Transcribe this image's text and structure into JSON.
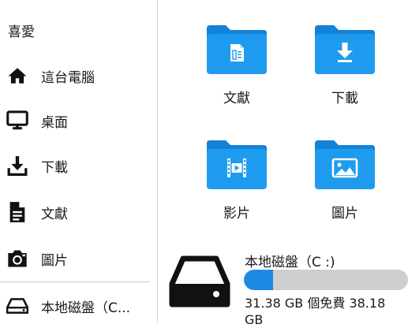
{
  "sidebar": {
    "header": "喜愛",
    "items": [
      {
        "label": "這台電腦",
        "icon": "home-icon"
      },
      {
        "label": "桌面",
        "icon": "desktop-monitor-icon"
      },
      {
        "label": "下載",
        "icon": "download-icon"
      },
      {
        "label": "文獻",
        "icon": "document-icon"
      },
      {
        "label": "圖片",
        "icon": "camera-icon"
      }
    ],
    "drive_item": {
      "label": "本地磁盤（C...",
      "icon": "hard-drive-icon"
    }
  },
  "main": {
    "folders": [
      {
        "label": "文獻",
        "icon": "folder-document-icon"
      },
      {
        "label": "下載",
        "icon": "folder-download-icon"
      },
      {
        "label": "影片",
        "icon": "folder-video-icon"
      },
      {
        "label": "圖片",
        "icon": "folder-image-icon"
      }
    ],
    "drive": {
      "name": "本地磁盤（C :)",
      "free_text": "31.38 GB 個免費 38.18 GB",
      "used_fraction": 0.18,
      "icon": "hard-drive-icon"
    }
  },
  "colors": {
    "folder_blue": "#1e9bef",
    "folder_tab_blue": "#1482d8",
    "accent": "#1e88e5"
  }
}
